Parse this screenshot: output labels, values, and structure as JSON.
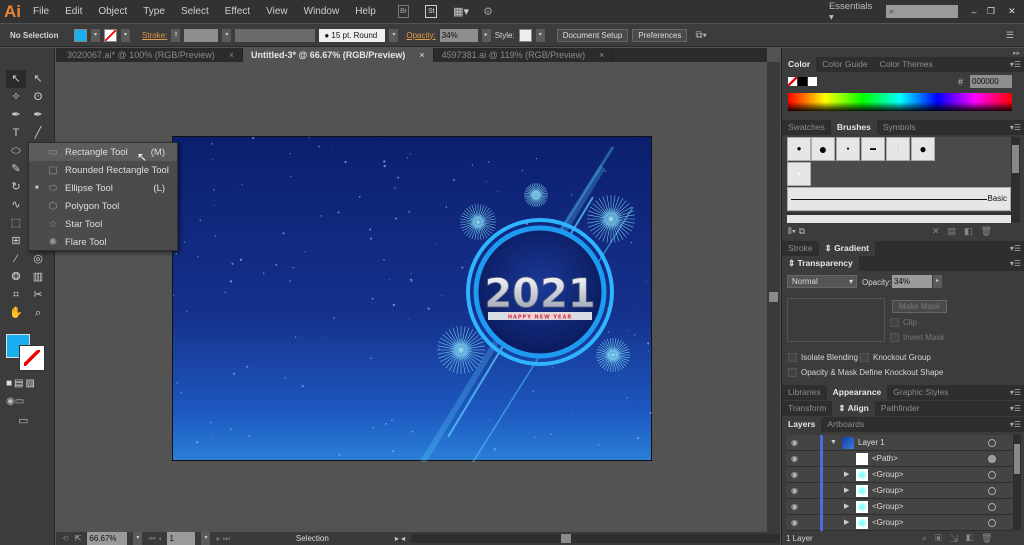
{
  "app": {
    "logo": "Ai",
    "menu": [
      "File",
      "Edit",
      "Object",
      "Type",
      "Select",
      "Effect",
      "View",
      "Window",
      "Help"
    ],
    "bridge": "Br",
    "stock": "St",
    "workspace": "Essentials",
    "window_controls": [
      "minimize",
      "restore",
      "close"
    ]
  },
  "control": {
    "selection": "No Selection",
    "fill_color": "#1ab0ef",
    "stroke_label": "Stroke:",
    "brush": "15 pt. Round",
    "opacity_label": "Opacity:",
    "opacity": "34%",
    "style_label": "Style:",
    "document_setup": "Document Setup",
    "preferences": "Preferences"
  },
  "doc_tabs": [
    {
      "label": "3020067.ai* @ 100% (RGB/Preview)",
      "active": false
    },
    {
      "label": "Untitled-3* @ 66.67% (RGB/Preview)",
      "active": true
    },
    {
      "label": "4597381.ai @ 119% (RGB/Preview)",
      "active": false
    }
  ],
  "flyout": [
    {
      "label": "Rectangle Tool",
      "shortcut": "(M)",
      "icon": "rectangle-icon"
    },
    {
      "label": "Rounded Rectangle Tool",
      "shortcut": "",
      "icon": "rounded-rectangle-icon"
    },
    {
      "label": "Ellipse Tool",
      "shortcut": "(L)",
      "icon": "ellipse-icon",
      "current": true
    },
    {
      "label": "Polygon Tool",
      "shortcut": "",
      "icon": "polygon-icon"
    },
    {
      "label": "Star Tool",
      "shortcut": "",
      "icon": "star-icon"
    },
    {
      "label": "Flare Tool",
      "shortcut": "",
      "icon": "flare-icon"
    }
  ],
  "artwork": {
    "year": "2021",
    "tagline": "HAPPY NEW YEAR"
  },
  "status": {
    "zoom": "66.67%",
    "artboard": "1",
    "tool": "Selection"
  },
  "panels": {
    "color": {
      "tabs": [
        "Color",
        "Color Guide",
        "Color Themes"
      ],
      "hex": "000000"
    },
    "brushes": {
      "tabs": [
        "Swatches",
        "Brushes",
        "Symbols"
      ],
      "basic": "Basic"
    },
    "stroke": {
      "tabs": [
        "Stroke",
        "Gradient"
      ]
    },
    "transparency": {
      "tab": "Transparency",
      "mode": "Normal",
      "opacity_label": "Opacity:",
      "opacity": "34%",
      "make_mask": "Make Mask",
      "clip": "Clip",
      "invert_mask": "Invert Mask",
      "isolate": "Isolate Blending",
      "knockout": "Knockout Group",
      "define_knockout": "Opacity & Mask Define Knockout Shape"
    },
    "appearance": {
      "tabs": [
        "Libraries",
        "Appearance",
        "Graphic Styles"
      ]
    },
    "align": {
      "tabs": [
        "Transform",
        "Align",
        "Pathfinder"
      ]
    },
    "layers": {
      "tabs": [
        "Layers",
        "Artboards"
      ],
      "rows": [
        {
          "name": "Layer 1",
          "level": 0
        },
        {
          "name": "<Path>",
          "level": 1
        },
        {
          "name": "<Group>",
          "level": 1
        },
        {
          "name": "<Group>",
          "level": 1
        },
        {
          "name": "<Group>",
          "level": 1
        },
        {
          "name": "<Group>",
          "level": 1
        }
      ],
      "footer": "1 Layer"
    }
  }
}
